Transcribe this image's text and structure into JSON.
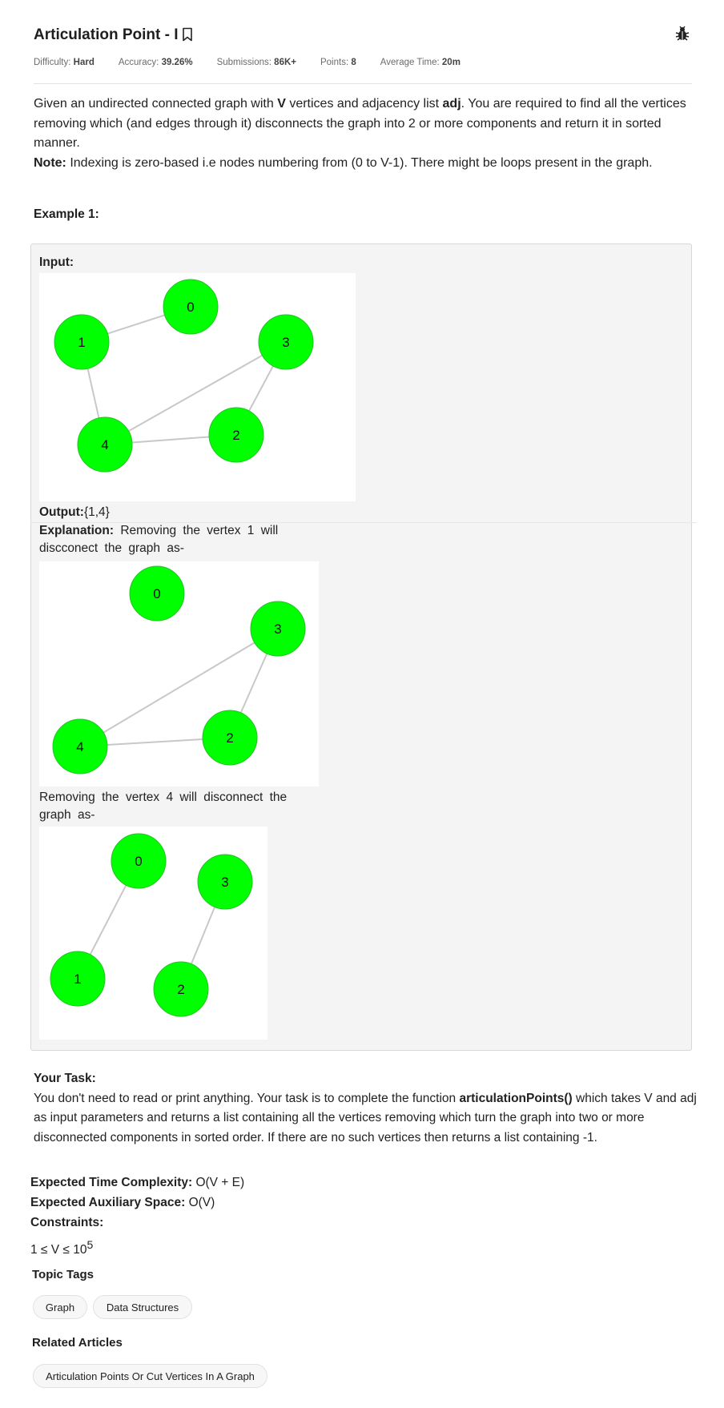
{
  "problem": {
    "title": "Articulation Point - I",
    "meta": [
      {
        "label": "Difficulty:",
        "value": "Hard"
      },
      {
        "label": "Accuracy:",
        "value": "39.26%"
      },
      {
        "label": "Submissions:",
        "value": "86K+"
      },
      {
        "label": "Points:",
        "value": "8"
      },
      {
        "label": "Average Time:",
        "value": "20m"
      }
    ]
  },
  "description": {
    "p1_a": "Given an undirected connected graph with ",
    "p1_V": "V",
    "p1_b": " vertices and adjacency list ",
    "p1_adj": "adj",
    "p1_c": ". You are required to find all the vertices removing which (and edges through it) disconnects the graph into 2 or more components and return it in sorted manner.",
    "note_label": "Note:",
    "note_text": " Indexing is zero-based i.e nodes numbering from (0 to V-1). There might be loops present in the graph."
  },
  "example": {
    "title": "Example 1:",
    "input_label": "Input:",
    "output_label": "Output:",
    "output_value": "{1,4}",
    "explanation_label": "Explanation:",
    "explanation_text": " Removing the vertex 1 will discconect the graph as-",
    "explanation_text2": "Removing the vertex 4 will disconnect the graph as-",
    "node_color": "#00ff00",
    "edge_color": "#c8c8c8",
    "graphs": {
      "input": {
        "nodes": [
          "0",
          "1",
          "2",
          "3",
          "4"
        ],
        "edges": [
          [
            "0",
            "1"
          ],
          [
            "1",
            "4"
          ],
          [
            "4",
            "2"
          ],
          [
            "4",
            "3"
          ],
          [
            "3",
            "2"
          ]
        ]
      },
      "removed1": {
        "nodes": [
          "0",
          "2",
          "3",
          "4"
        ],
        "edges": [
          [
            "4",
            "2"
          ],
          [
            "4",
            "3"
          ],
          [
            "3",
            "2"
          ]
        ]
      },
      "removed4": {
        "nodes": [
          "0",
          "1",
          "2",
          "3"
        ],
        "edges": [
          [
            "0",
            "1"
          ],
          [
            "3",
            "2"
          ]
        ]
      }
    }
  },
  "task": {
    "heading": "Your Task:",
    "text_a": "You don't need to read or print anything. Your task is to complete the function ",
    "func": "articulationPoints()",
    "text_b": " which takes V and adj as input parameters and returns a list containing all the vertices removing which turn the graph into two or more disconnected components in sorted order. If there are no such vertices then returns a list containing -1."
  },
  "complexity": {
    "time_label": "Expected Time Complexity:",
    "time_value": " O(V + E)",
    "space_label": "Expected Auxiliary Space:",
    "space_value": " O(V)",
    "constraints_label": "Constraints:",
    "constraint_base": "1 ≤ V ≤ 10",
    "constraint_exp": "5"
  },
  "topic_tags": {
    "title": "Topic Tags",
    "tags": [
      "Graph",
      "Data Structures"
    ]
  },
  "related": {
    "title": "Related Articles",
    "articles": [
      "Articulation Points Or Cut Vertices In A Graph"
    ]
  }
}
